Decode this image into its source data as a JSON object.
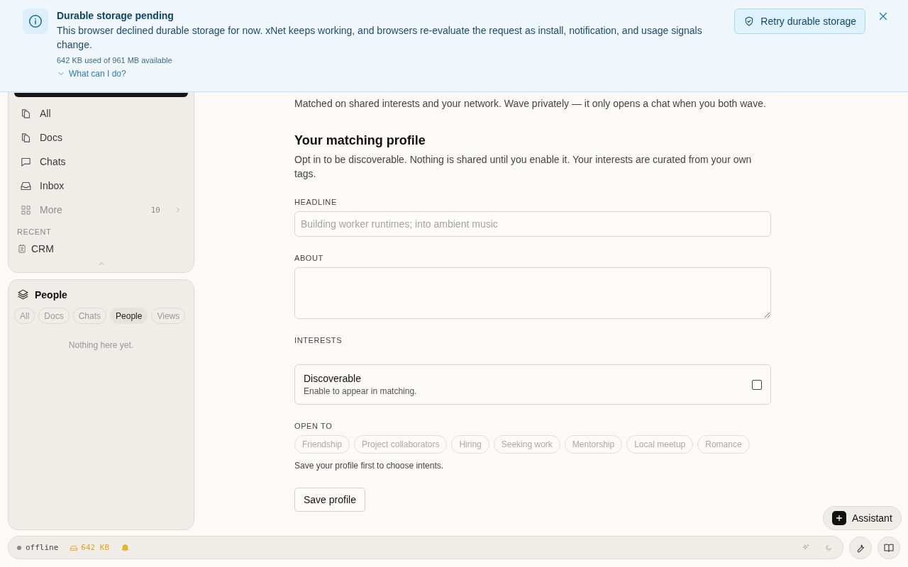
{
  "banner": {
    "title": "Durable storage pending",
    "message": "This browser declined durable storage for now. xNet keeps working, and browsers re-evaluate the request as install, notification, and usage signals change.",
    "usage": "642 KB used of 961 MB available",
    "help_link": "What can I do?",
    "retry_button": "Retry durable storage"
  },
  "sidebar": {
    "nav": [
      {
        "label": "All",
        "kind": "pages"
      },
      {
        "label": "Docs",
        "kind": "pages"
      },
      {
        "label": "Chats",
        "kind": "chat"
      },
      {
        "label": "Inbox",
        "kind": "inbox"
      }
    ],
    "more": {
      "label": "More",
      "count": "10"
    },
    "recent_heading": "RECENT",
    "recent": [
      {
        "label": "CRM"
      }
    ]
  },
  "people_panel": {
    "title": "People",
    "filters": [
      {
        "label": "All",
        "selected": false
      },
      {
        "label": "Docs",
        "selected": false
      },
      {
        "label": "Chats",
        "selected": false
      },
      {
        "label": "People",
        "selected": true
      },
      {
        "label": "Views",
        "selected": false
      }
    ],
    "empty": "Nothing here yet."
  },
  "main": {
    "intro": "Matched on shared interests and your network. Wave privately — it only opens a chat when you both wave.",
    "section_title": "Your matching profile",
    "description": "Opt in to be discoverable. Nothing is shared until you enable it. Your interests are curated from your own tags.",
    "headline": {
      "label": "HEADLINE",
      "placeholder": "Building worker runtimes; into ambient music"
    },
    "about": {
      "label": "ABOUT"
    },
    "interests_label": "INTERESTS",
    "discoverable": {
      "title": "Discoverable",
      "hint": "Enable to appear in matching.",
      "checked": false
    },
    "open_to": {
      "label": "OPEN TO",
      "intents": [
        {
          "label": "Friendship",
          "disabled": true
        },
        {
          "label": "Project collaborators",
          "disabled": true
        },
        {
          "label": "Hiring",
          "disabled": true
        },
        {
          "label": "Seeking work",
          "disabled": true
        },
        {
          "label": "Mentorship",
          "disabled": true
        },
        {
          "label": "Local meetup",
          "disabled": true
        },
        {
          "label": "Romance",
          "disabled": true
        }
      ],
      "hint": "Save your profile first to choose intents."
    },
    "save_button": "Save profile"
  },
  "assistant_button": "Assistant",
  "status_bar": {
    "connection": "offline",
    "storage": "642 KB"
  }
}
